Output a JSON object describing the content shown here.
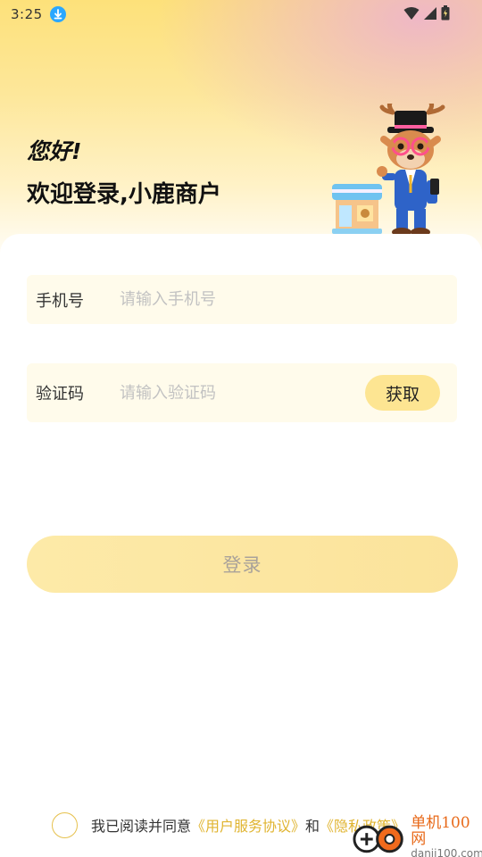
{
  "status_bar": {
    "time": "3:25"
  },
  "header": {
    "greeting": "您好!",
    "welcome": "欢迎登录,小鹿商户"
  },
  "form": {
    "phone": {
      "label": "手机号",
      "placeholder": "请输入手机号"
    },
    "code": {
      "label": "验证码",
      "placeholder": "请输入验证码",
      "button_label": "获取"
    }
  },
  "login_button": {
    "label": "登录"
  },
  "agreement": {
    "prefix": "我已阅读并同意",
    "terms_link": "《用户服务协议》",
    "and": "和",
    "privacy_link": "《隐私政策》"
  },
  "watermark": {
    "cn": "单机100网",
    "en": "danji100.com"
  },
  "colors": {
    "accent": "#fde592",
    "link": "#e0b430",
    "field_bg": "#fffbeb",
    "login_button": "#fbe39b"
  }
}
